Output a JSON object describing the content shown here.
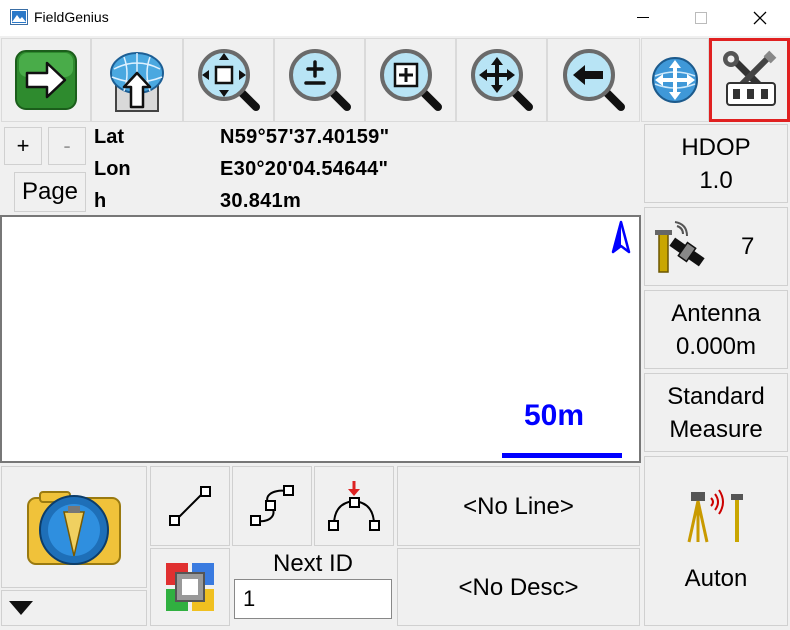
{
  "window": {
    "title": "FieldGenius",
    "minimize_icon": "minimize-icon",
    "maximize_icon": "maximize-icon",
    "close_icon": "close-icon"
  },
  "toolbar": [
    {
      "name": "next-arrow-button",
      "icon": "green-right-arrow-icon"
    },
    {
      "name": "globe-upload-button",
      "icon": "globe-up-arrow-icon"
    },
    {
      "name": "zoom-extents-button",
      "icon": "zoom-extents-icon"
    },
    {
      "name": "zoom-in-out-button",
      "icon": "zoom-plus-minus-icon"
    },
    {
      "name": "zoom-window-button",
      "icon": "zoom-window-icon"
    },
    {
      "name": "pan-button",
      "icon": "zoom-pan-icon"
    },
    {
      "name": "zoom-previous-button",
      "icon": "zoom-back-icon"
    },
    {
      "name": "globe-move-button",
      "icon": "globe-cross-arrows-icon"
    },
    {
      "name": "instrument-settings-button",
      "icon": "tools-instrument-icon",
      "highlighted": true
    }
  ],
  "zoom_controls": {
    "plus": "+",
    "minus": "-",
    "page": "Page"
  },
  "position": {
    "lat_label": "Lat",
    "lat_value": "N59°57'37.40159\"",
    "lon_label": "Lon",
    "lon_value": "E30°20'04.54644\"",
    "h_label": "h",
    "h_value": "30.841m"
  },
  "map": {
    "scale_label": "50m",
    "north_icon": "north-arrow-icon",
    "scale_color": "#0000ff"
  },
  "status": {
    "hdop_label": "HDOP",
    "hdop_value": "1.0",
    "satellites": "7",
    "antenna_label": "Antenna",
    "antenna_value": "0.000m",
    "measure_line1": "Standard",
    "measure_line2": "Measure",
    "auto_label": "Auton"
  },
  "bottom": {
    "line_label": "<No Line>",
    "desc_label": "<No Desc>",
    "next_id_label": "Next ID",
    "next_id_value": "1"
  },
  "colors": {
    "highlight": "#e02020",
    "accent_blue": "#0000ff"
  }
}
